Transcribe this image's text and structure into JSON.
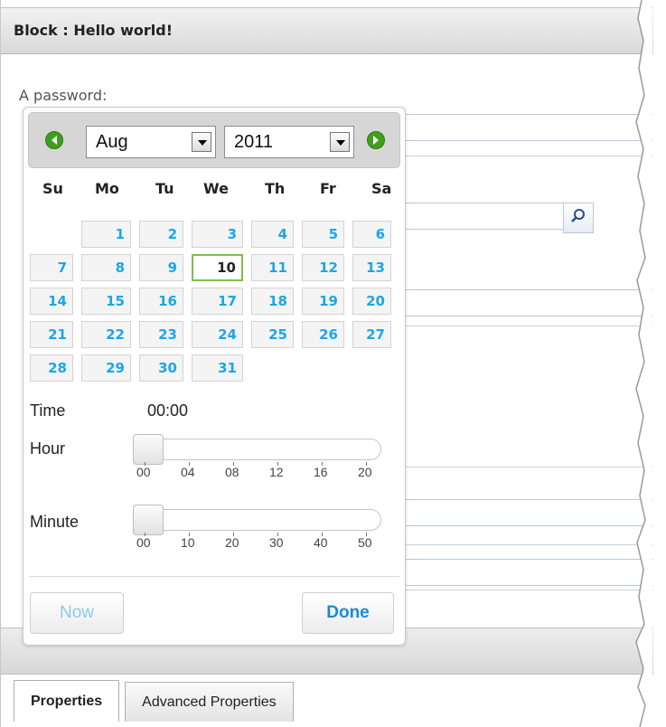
{
  "panel": {
    "title": "Block : Hello world!",
    "field_label": "A password:"
  },
  "tabs": [
    "Properties",
    "Advanced Properties"
  ],
  "datepicker": {
    "month": "Aug",
    "year": "2011",
    "weekdays": [
      "Su",
      "Mo",
      "Tu",
      "We",
      "Th",
      "Fr",
      "Sa"
    ],
    "weeks": [
      [
        "",
        "1",
        "2",
        "3",
        "4",
        "5",
        "6"
      ],
      [
        "7",
        "8",
        "9",
        "10",
        "11",
        "12",
        "13"
      ],
      [
        "14",
        "15",
        "16",
        "17",
        "18",
        "19",
        "20"
      ],
      [
        "21",
        "22",
        "23",
        "24",
        "25",
        "26",
        "27"
      ],
      [
        "28",
        "29",
        "30",
        "31",
        "",
        "",
        ""
      ]
    ],
    "today": "10",
    "time_label": "Time",
    "time_value": "00:00",
    "hour_label": "Hour",
    "hour_ticks": [
      "00",
      "04",
      "08",
      "12",
      "16",
      "20"
    ],
    "hour_value": 0,
    "minute_label": "Minute",
    "minute_ticks": [
      "00",
      "10",
      "20",
      "30",
      "40",
      "50"
    ],
    "minute_value": 0,
    "now_label": "Now",
    "done_label": "Done"
  },
  "icons": {
    "prev": "arrow-left-icon",
    "next": "arrow-right-icon",
    "search": "search-icon"
  },
  "colors": {
    "day_text": "#1ca6e8",
    "nav_green": "#3f9f1d",
    "today_border": "#7ec04a"
  }
}
